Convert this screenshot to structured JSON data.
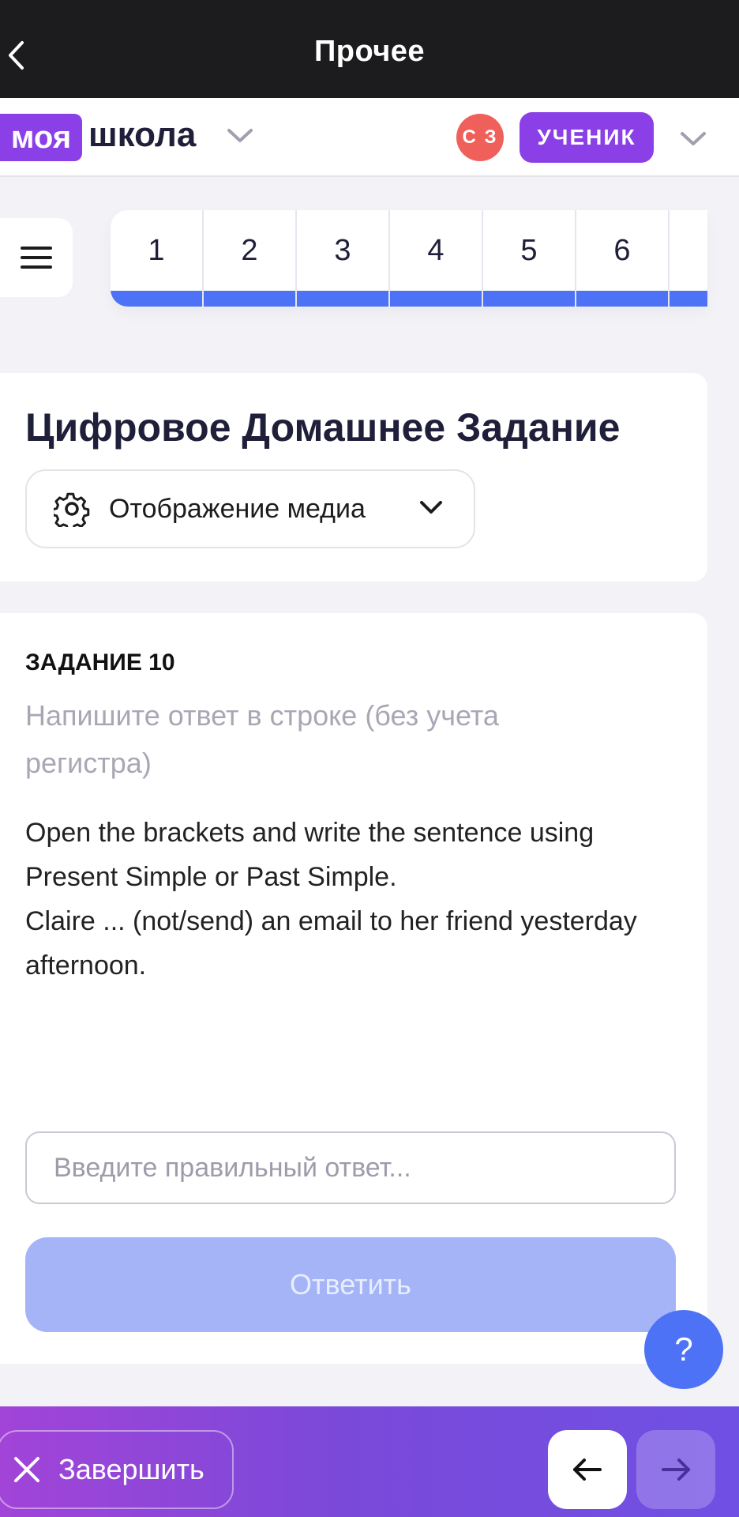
{
  "topbar": {
    "title": "Прочее",
    "back_icon": "chevron-left-icon"
  },
  "header": {
    "logo_box": "моя",
    "logo_text": "школа",
    "avatar_initials": "С З",
    "role_label": "УЧЕНИК",
    "colors": {
      "brand_purple": "#8b3fe6",
      "avatar_red": "#f0605a"
    }
  },
  "tabs": {
    "items": [
      "1",
      "2",
      "3",
      "4",
      "5",
      "6",
      ""
    ],
    "accent": "#4e72f5"
  },
  "assignment": {
    "title": "Цифровое Домашнее Задание",
    "media_toggle_label": "Отображение медиа"
  },
  "task": {
    "number_label": "ЗАДАНИЕ 10",
    "instruction": "Напишите ответ в строке (без учета регистра)",
    "question_line1": "Open the brackets and write the sentence using Present Simple or Past Simple.",
    "question_line2": "Claire ... (not/send) an email to her friend yesterday afternoon.",
    "answer_placeholder": "Введите правильный ответ...",
    "submit_label": "Ответить"
  },
  "help": {
    "label": "?"
  },
  "bottombar": {
    "finish_label": "Завершить"
  }
}
